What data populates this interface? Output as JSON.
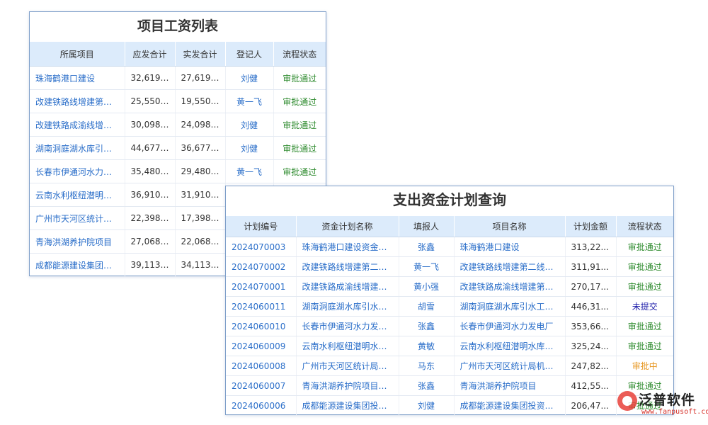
{
  "salary_panel": {
    "title": "项目工资列表",
    "headers": [
      "所属项目",
      "应发合计",
      "实发合计",
      "登记人",
      "流程状态"
    ],
    "rows": [
      {
        "project": "珠海鹤港口建设",
        "payable": "32,619.00",
        "actual": "27,619.00",
        "registrar": "刘健",
        "status": "审批通过"
      },
      {
        "project": "改建铁路线增建第二...",
        "payable": "25,550.00",
        "actual": "19,550.00",
        "registrar": "黄一飞",
        "status": "审批通过"
      },
      {
        "project": "改建铁路成渝线增建...",
        "payable": "30,098.00",
        "actual": "24,098.00",
        "registrar": "刘健",
        "status": "审批通过"
      },
      {
        "project": "湖南洞庭湖水库引水...",
        "payable": "44,677.00",
        "actual": "36,677.00",
        "registrar": "刘健",
        "status": "审批通过"
      },
      {
        "project": "长春市伊通河水力发...",
        "payable": "35,480.00",
        "actual": "29,480.00",
        "registrar": "黄一飞",
        "status": "审批通过"
      },
      {
        "project": "云南水利枢纽潜明水...",
        "payable": "36,910.00",
        "actual": "31,910.00",
        "registrar": "",
        "status": ""
      },
      {
        "project": "广州市天河区统计局...",
        "payable": "22,398.00",
        "actual": "17,398.00",
        "registrar": "",
        "status": ""
      },
      {
        "project": "青海洪湖养护院项目",
        "payable": "27,068.00",
        "actual": "22,068.00",
        "registrar": "",
        "status": ""
      },
      {
        "project": "成都能源建设集团投...",
        "payable": "39,113.00",
        "actual": "34,113.00",
        "registrar": "",
        "status": ""
      }
    ]
  },
  "plan_panel": {
    "title": "支出资金计划查询",
    "headers": [
      "计划编号",
      "资金计划名称",
      "填报人",
      "项目名称",
      "计划金额",
      "流程状态"
    ],
    "rows": [
      {
        "code": "2024070003",
        "plan_name": "珠海鹤港口建设资金计划",
        "reporter": "张鑫",
        "project": "珠海鹤港口建设",
        "amount": "313,22...",
        "status": "审批通过",
        "status_type": "ok"
      },
      {
        "code": "2024070002",
        "plan_name": "改建铁路线增建第二线直通",
        "reporter": "黄一飞",
        "project": "改建铁路线增建第二线直通",
        "amount": "311,91...",
        "status": "审批通过",
        "status_type": "ok"
      },
      {
        "code": "2024070001",
        "plan_name": "改建铁路成渝线增建第二线",
        "reporter": "黄小强",
        "project": "改建铁路成渝线增建第二线",
        "amount": "270,17...",
        "status": "审批通过",
        "status_type": "ok"
      },
      {
        "code": "2024060011",
        "plan_name": "湖南洞庭湖水库引水工程",
        "reporter": "胡雪",
        "project": "湖南洞庭湖水库引水工程施工",
        "amount": "446,31...",
        "status": "未提交",
        "status_type": "none"
      },
      {
        "code": "2024060010",
        "plan_name": "长春市伊通河水力发电厂",
        "reporter": "张鑫",
        "project": "长春市伊通河水力发电厂",
        "amount": "353,66...",
        "status": "审批通过",
        "status_type": "ok"
      },
      {
        "code": "2024060009",
        "plan_name": "云南水利枢纽潜明水库一期",
        "reporter": "黄敏",
        "project": "云南水利枢纽潜明水库一期",
        "amount": "325,24...",
        "status": "审批通过",
        "status_type": "ok"
      },
      {
        "code": "2024060008",
        "plan_name": "广州市天河区统计局机房",
        "reporter": "马东",
        "project": "广州市天河区统计局机房改造",
        "amount": "247,82...",
        "status": "审批中",
        "status_type": "pending"
      },
      {
        "code": "2024060007",
        "plan_name": "青海洪湖养护院项目资金",
        "reporter": "张鑫",
        "project": "青海洪湖养护院项目",
        "amount": "412,55...",
        "status": "审批通过",
        "status_type": "ok"
      },
      {
        "code": "2024060006",
        "plan_name": "成都能源建设集团投资有",
        "reporter": "刘健",
        "project": "成都能源建设集团投资有限",
        "amount": "206,47...",
        "status": "审批通过",
        "status_type": "ok"
      }
    ]
  },
  "watermark": {
    "brand": "泛普软件",
    "url": "www.fanpusoft.com",
    "logo_color": "#e8413a"
  },
  "colors": {
    "header_bg": "#dcebfb",
    "link_blue": "#2a6ec9",
    "status_ok": "#2e8b2e",
    "status_none": "#1a1aa8",
    "status_pending": "#e7961f"
  }
}
